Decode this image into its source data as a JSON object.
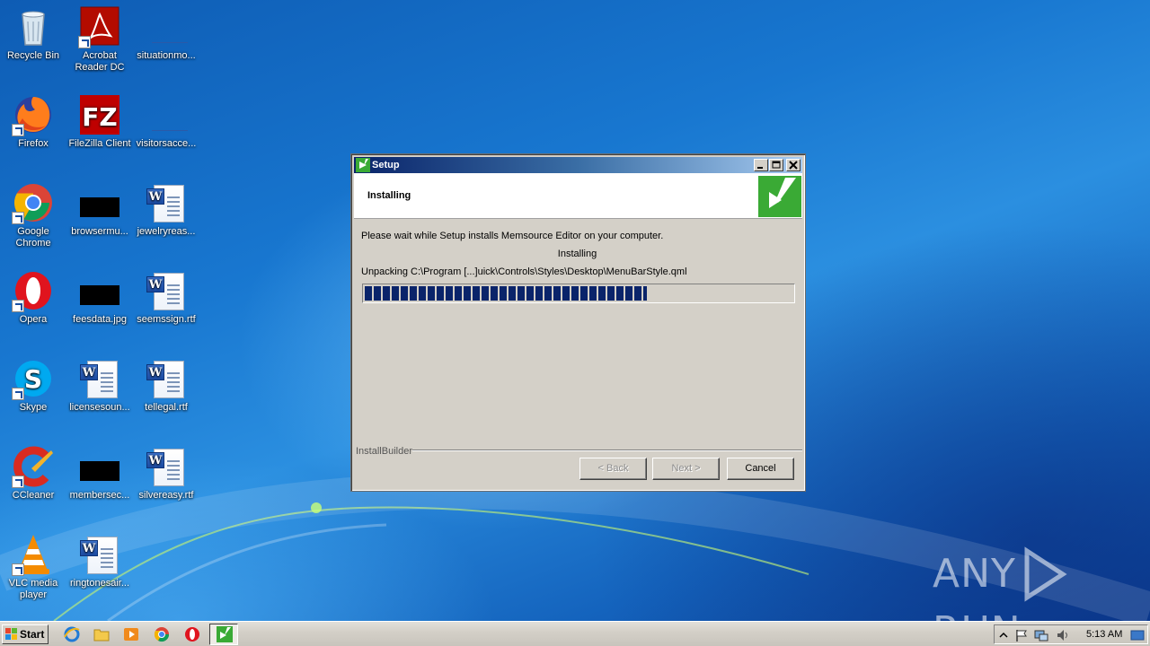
{
  "desktop": {
    "icons": [
      {
        "label": "Recycle Bin",
        "icon": "recycle-bin-icon"
      },
      {
        "label": "Acrobat Reader DC",
        "icon": "acrobat-reader-icon"
      },
      {
        "label": "situationmo...",
        "icon": "blank-file-icon"
      },
      {
        "label": "Firefox",
        "icon": "firefox-icon"
      },
      {
        "label": "FileZilla Client",
        "icon": "filezilla-icon"
      },
      {
        "label": "visitorsacce...",
        "icon": "blank-file-icon"
      },
      {
        "label": "Google Chrome",
        "icon": "chrome-icon"
      },
      {
        "label": "browsermu...",
        "icon": "black-image-icon"
      },
      {
        "label": "jewelryreas...",
        "icon": "word-doc-icon"
      },
      {
        "label": "Opera",
        "icon": "opera-icon"
      },
      {
        "label": "feesdata.jpg",
        "icon": "black-image-icon"
      },
      {
        "label": "seemssign.rtf",
        "icon": "word-doc-icon"
      },
      {
        "label": "Skype",
        "icon": "skype-icon"
      },
      {
        "label": "licensesoun...",
        "icon": "word-doc-icon"
      },
      {
        "label": "tellegal.rtf",
        "icon": "word-doc-icon"
      },
      {
        "label": "CCleaner",
        "icon": "ccleaner-icon"
      },
      {
        "label": "membersec...",
        "icon": "black-image-icon"
      },
      {
        "label": "silvereasy.rtf",
        "icon": "word-doc-icon"
      },
      {
        "label": "VLC media player",
        "icon": "vlc-icon"
      },
      {
        "label": "ringtonesair...",
        "icon": "word-doc-icon"
      }
    ]
  },
  "setup_window": {
    "title": "Setup",
    "header_title": "Installing",
    "message": "Please wait while Setup installs Memsource Editor on your computer.",
    "status": "Installing",
    "detail": "Unpacking C:\\Program [...]uick\\Controls\\Styles\\Desktop\\MenuBarStyle.qml",
    "progress_fraction": 0.66,
    "brand": "InstallBuilder",
    "buttons": {
      "back": "< Back",
      "next": "Next >",
      "cancel": "Cancel"
    },
    "accent_color": "#3aaa35",
    "titlebar_color": "#0a246a"
  },
  "watermark": {
    "left": "ANY",
    "right": "RUN"
  },
  "taskbar": {
    "start_label": "Start",
    "clock": "5:13 AM",
    "pinned": [
      "internet-explorer-icon",
      "folder-icon",
      "media-player-icon",
      "chrome-icon",
      "opera-icon",
      "setup-icon"
    ]
  }
}
